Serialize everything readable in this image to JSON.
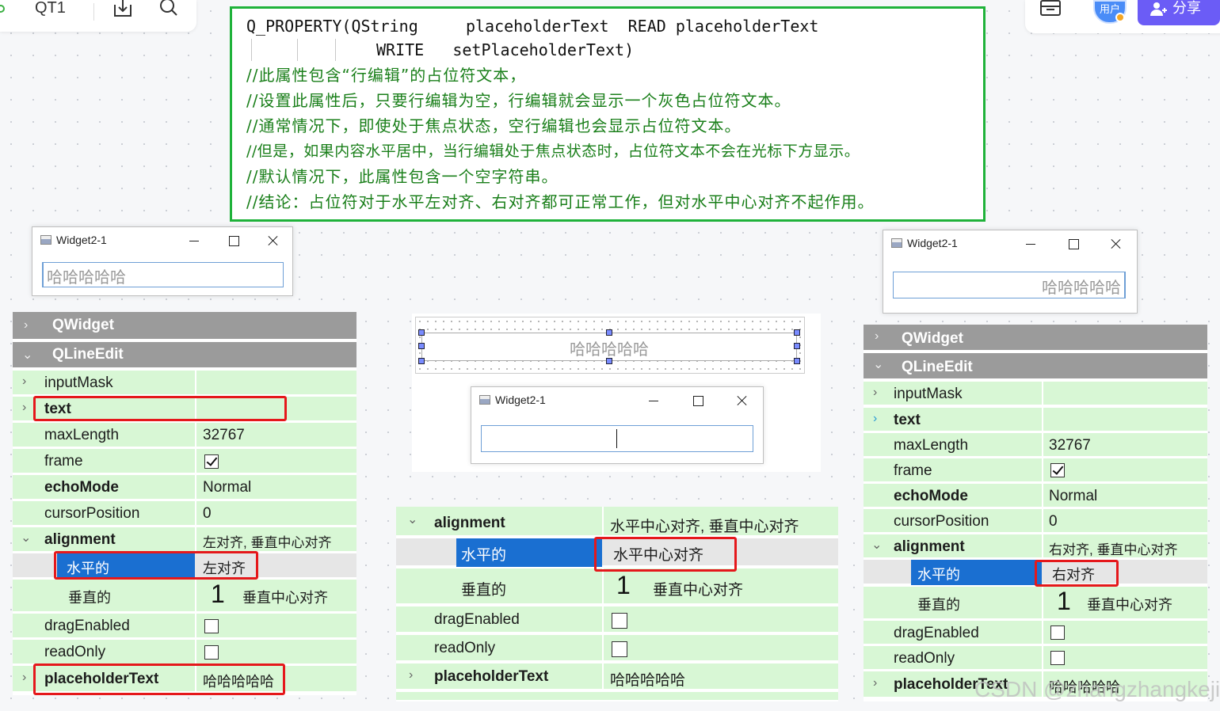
{
  "toolbar": {
    "doc_title": "QT1",
    "user_label": "用户",
    "share_label": "分享"
  },
  "code": {
    "line1": "Q_PROPERTY(QString     placeholderText  READ placeholderText",
    "line2": "WRITE   setPlaceholderText)",
    "comments": [
      "//此属性包含“行编辑”的占位符文本，",
      "//设置此属性后，只要行编辑为空，行编辑就会显示一个灰色占位符文本。",
      "//通常情况下，即使处于焦点状态，空行编辑也会显示占位符文本。",
      "//但是，如果内容水平居中，当行编辑处于焦点状态时，占位符文本不会在光标下方显示。",
      "//默认情况下，此属性包含一个空字符串。",
      "//结论：占位符对于水平左对齐、右对齐都可正常工作，但对水平中心对齐不起作用。"
    ]
  },
  "windows": {
    "left": {
      "title": "Widget2-1",
      "placeholder": "哈哈哈哈哈"
    },
    "right": {
      "title": "Widget2-1",
      "placeholder": "哈哈哈哈哈"
    },
    "center": {
      "title": "Widget2-1"
    },
    "designer_placeholder": "哈哈哈哈哈"
  },
  "grid_left": {
    "hdr_qwidget": "QWidget",
    "hdr_qlineedit": "QLineEdit",
    "inputMask": "inputMask",
    "text": "text",
    "maxLength": "maxLength",
    "maxLength_val": "32767",
    "frame": "frame",
    "echoMode": "echoMode",
    "echoMode_val": "Normal",
    "cursorPosition": "cursorPosition",
    "cursorPosition_val": "0",
    "alignment": "alignment",
    "alignment_val": "左对齐, 垂直中心对齐",
    "horizontal": "水平的",
    "horizontal_val": "左对齐",
    "vertical": "垂直的",
    "vertical_num": "1",
    "vertical_val": "垂直中心对齐",
    "dragEnabled": "dragEnabled",
    "readOnly": "readOnly",
    "placeholderText": "placeholderText",
    "placeholderText_val": "哈哈哈哈哈"
  },
  "grid_center": {
    "alignment": "alignment",
    "alignment_val": "水平中心对齐, 垂直中心对齐",
    "horizontal": "水平的",
    "horizontal_val": "水平中心对齐",
    "vertical": "垂直的",
    "vertical_num": "1",
    "vertical_val": "垂直中心对齐",
    "dragEnabled": "dragEnabled",
    "readOnly": "readOnly",
    "placeholderText": "placeholderText",
    "placeholderText_val": "哈哈哈哈哈"
  },
  "grid_right": {
    "hdr_qwidget": "QWidget",
    "hdr_qlineedit": "QLineEdit",
    "inputMask": "inputMask",
    "text": "text",
    "maxLength": "maxLength",
    "maxLength_val": "32767",
    "frame": "frame",
    "echoMode": "echoMode",
    "echoMode_val": "Normal",
    "cursorPosition": "cursorPosition",
    "cursorPosition_val": "0",
    "alignment": "alignment",
    "alignment_val": "右对齐, 垂直中心对齐",
    "horizontal": "水平的",
    "horizontal_val": "右对齐",
    "vertical": "垂直的",
    "vertical_num": "1",
    "vertical_val": "垂直中心对齐",
    "dragEnabled": "dragEnabled",
    "readOnly": "readOnly",
    "placeholderText": "placeholderText",
    "placeholderText_val": "哈哈哈哈哈"
  },
  "watermark": "CSDN @zhangzhangkeji"
}
